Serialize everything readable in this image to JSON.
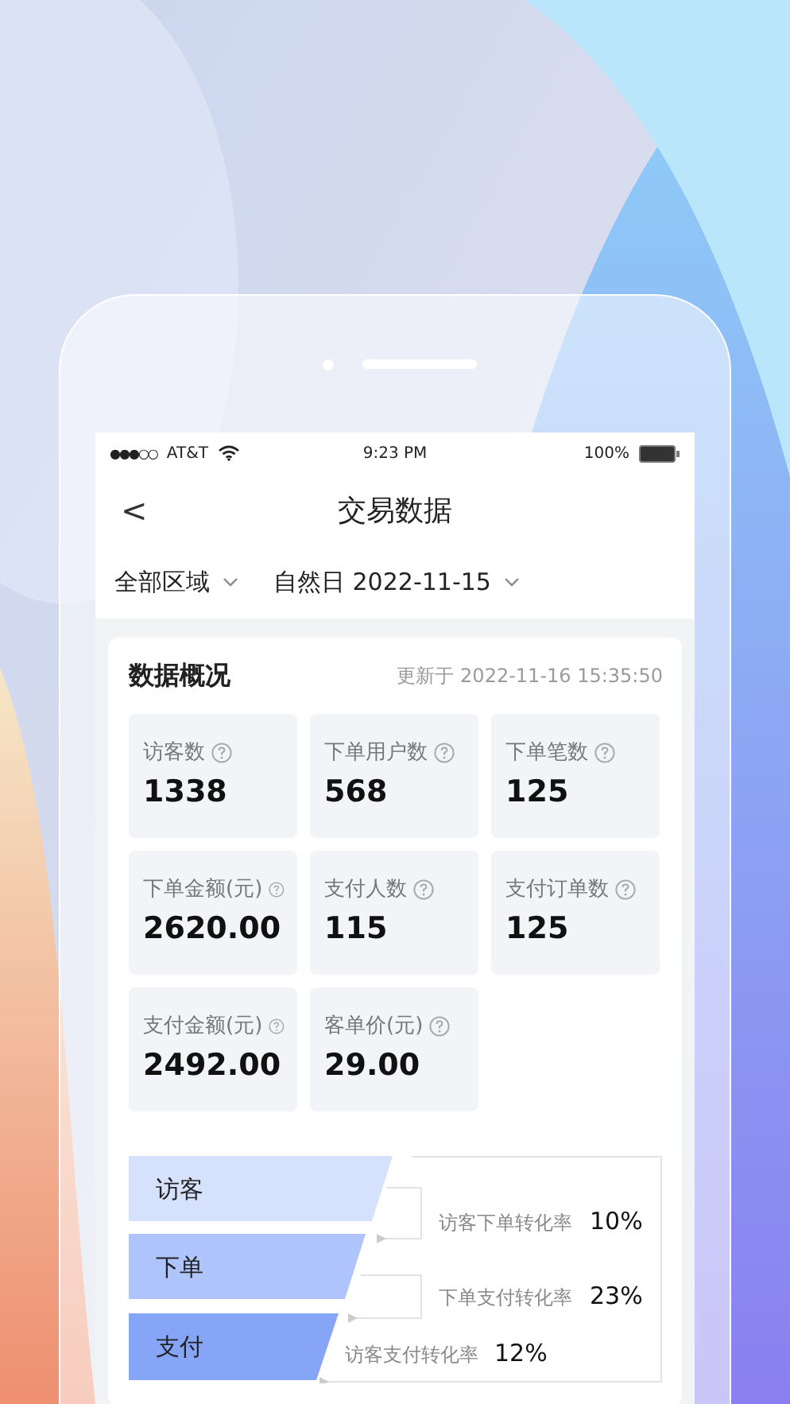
{
  "status_bar": {
    "carrier": "AT&T",
    "time": "9:23 PM",
    "battery": "100%",
    "signal_dots": "●●●○○"
  },
  "header": {
    "back": "<",
    "title": "交易数据"
  },
  "filters": [
    {
      "label": "全部区域"
    },
    {
      "label": "自然日 2022-11-15"
    }
  ],
  "overview": {
    "title": "数据概况",
    "updated": "更新于 2022-11-16 15:35:50",
    "metrics": [
      {
        "label": "访客数",
        "value": "1338"
      },
      {
        "label": "下单用户数",
        "value": "568"
      },
      {
        "label": "下单笔数",
        "value": "125"
      },
      {
        "label": "下单金额(元)",
        "value": "2620.00"
      },
      {
        "label": "支付人数",
        "value": "115"
      },
      {
        "label": "支付订单数",
        "value": "125"
      },
      {
        "label": "支付金额(元)",
        "value": "2492.00"
      },
      {
        "label": "客单价(元)",
        "value": "29.00"
      }
    ]
  },
  "funnel": {
    "stages": [
      {
        "label": "访客",
        "color": "#d6e2fd"
      },
      {
        "label": "下单",
        "color": "#aec4fb"
      },
      {
        "label": "支付",
        "color": "#86a5f7"
      }
    ],
    "rates": [
      {
        "label": "访客下单转化率",
        "value": "10%"
      },
      {
        "label": "下单支付转化率",
        "value": "23%"
      },
      {
        "label": "访客支付转化率",
        "value": "12%"
      }
    ]
  }
}
